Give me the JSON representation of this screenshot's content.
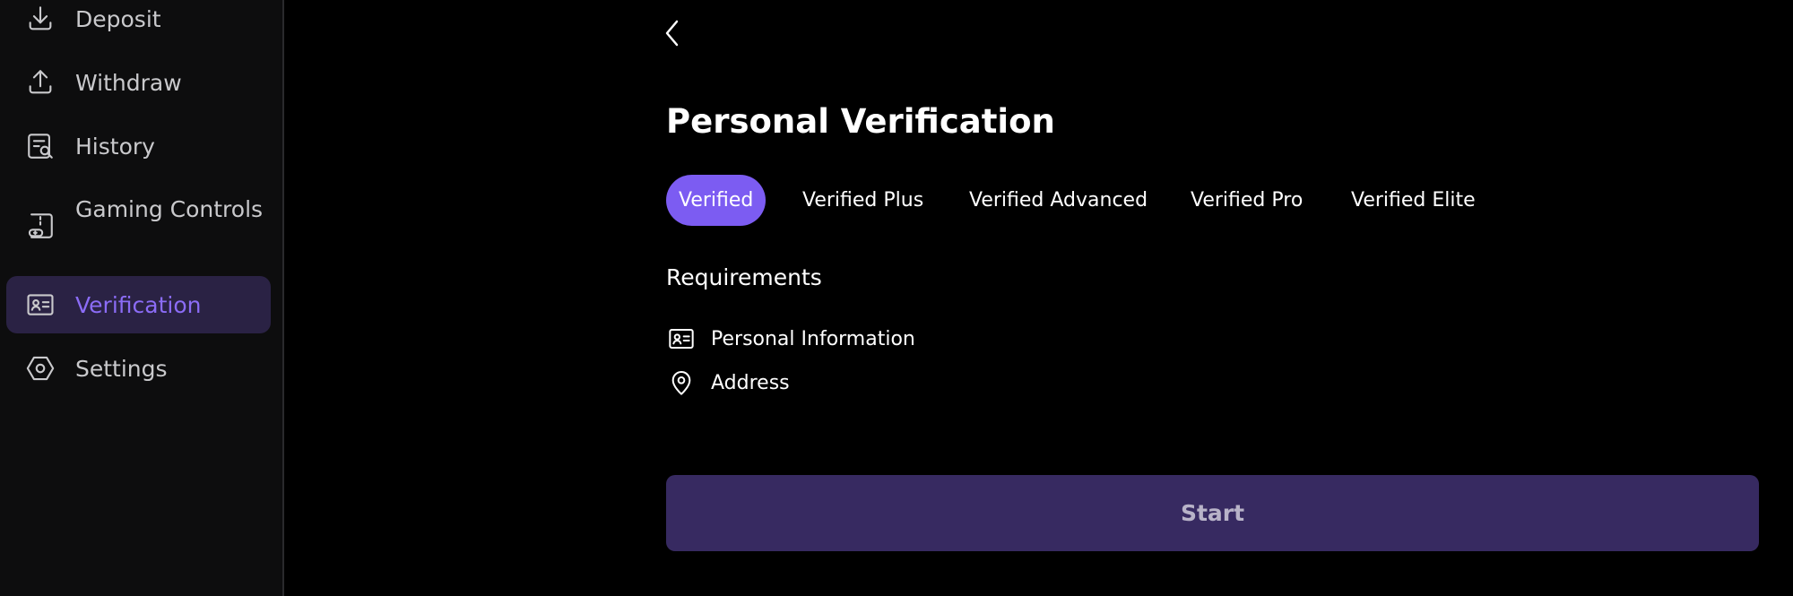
{
  "sidebar": {
    "items": [
      {
        "label": "Deposit",
        "icon": "download-icon"
      },
      {
        "label": "Withdraw",
        "icon": "upload-icon"
      },
      {
        "label": "History",
        "icon": "history-icon"
      },
      {
        "label": "Gaming Controls",
        "icon": "gamepad-icon"
      },
      {
        "label": "Verification",
        "icon": "id-card-icon",
        "active": true
      },
      {
        "label": "Settings",
        "icon": "settings-icon"
      }
    ]
  },
  "main": {
    "title": "Personal Verification",
    "tabs": [
      {
        "label": "Verified",
        "active": true
      },
      {
        "label": "Verified Plus"
      },
      {
        "label": "Verified Advanced"
      },
      {
        "label": "Verified Pro"
      },
      {
        "label": "Verified Elite"
      }
    ],
    "requirements_title": "Requirements",
    "requirements": [
      {
        "label": "Personal Information",
        "icon": "id-card-icon"
      },
      {
        "label": "Address",
        "icon": "location-pin-icon"
      }
    ],
    "start_label": "Start"
  },
  "colors": {
    "accent": "#7c5cf2",
    "active_nav_bg": "#2a2244",
    "start_button_bg": "#372a61"
  }
}
